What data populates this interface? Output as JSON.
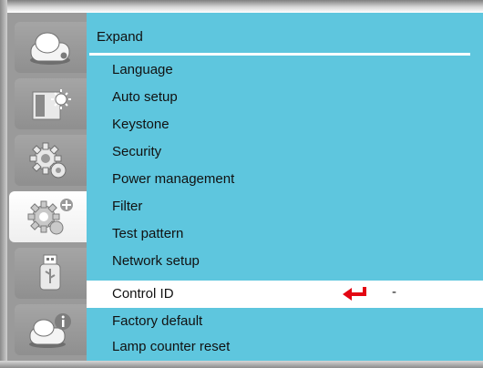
{
  "menu": {
    "title": "Expand",
    "items": [
      {
        "label": "Language"
      },
      {
        "label": "Auto setup"
      },
      {
        "label": "Keystone"
      },
      {
        "label": "Security"
      },
      {
        "label": "Power management"
      },
      {
        "label": "Filter"
      },
      {
        "label": "Test pattern"
      },
      {
        "label": "Network setup"
      },
      {
        "label": "Control ID",
        "value": "-",
        "selected": true
      },
      {
        "label": "Factory default"
      },
      {
        "label": "Lamp counter reset"
      }
    ]
  },
  "sidebar": {
    "tabs": [
      {
        "icon": "projector-icon",
        "active": false
      },
      {
        "icon": "brightness-icon",
        "active": false
      },
      {
        "icon": "gear-icon",
        "active": false
      },
      {
        "icon": "gear-plus-icon",
        "active": true
      },
      {
        "icon": "usb-icon",
        "active": false
      },
      {
        "icon": "projector-info-icon",
        "active": false
      }
    ]
  },
  "colors": {
    "menu_background": "#5ec6de",
    "selected_background": "#ffffff",
    "sidebar_background": "#9a9a9a",
    "enter_arrow": "#e30613"
  }
}
